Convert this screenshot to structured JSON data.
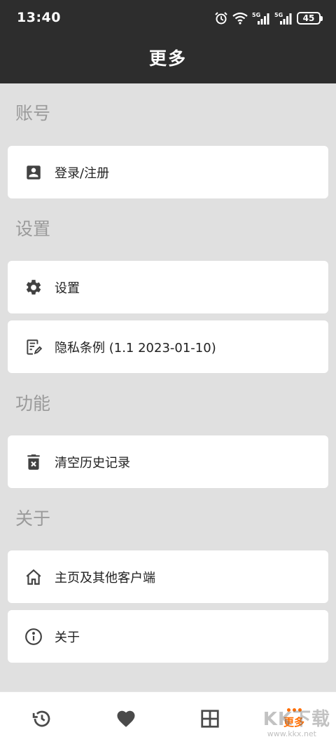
{
  "status_bar": {
    "time": "13:40",
    "battery": "45",
    "net1": "5G",
    "net2": "5G"
  },
  "header": {
    "title": "更多"
  },
  "sections": {
    "account": {
      "label": "账号",
      "items": [
        {
          "label": "登录/注册",
          "icon": "account-box-icon"
        }
      ]
    },
    "settings": {
      "label": "设置",
      "items": [
        {
          "label": "设置",
          "icon": "gear-icon"
        },
        {
          "label": "隐私条例 (1.1 2023-01-10)",
          "icon": "document-edit-icon"
        }
      ]
    },
    "features": {
      "label": "功能",
      "items": [
        {
          "label": "清空历史记录",
          "icon": "trash-icon"
        }
      ]
    },
    "about": {
      "label": "关于",
      "items": [
        {
          "label": "主页及其他客户端",
          "icon": "home-icon"
        },
        {
          "label": "关于",
          "icon": "info-icon"
        }
      ]
    }
  },
  "bottom_nav": [
    {
      "icon": "history-icon"
    },
    {
      "icon": "heart-icon"
    },
    {
      "icon": "grid-icon"
    },
    {
      "icon": "more-dots-icon",
      "label": "更多",
      "active": true
    }
  ],
  "watermark": {
    "main": "KK下载",
    "sub": "www.kkx.net"
  },
  "colors": {
    "header_bg": "#2d2d2d",
    "page_bg": "#e0e0e0",
    "accent": "#ff6d00",
    "section_label": "#9a9a9a"
  }
}
